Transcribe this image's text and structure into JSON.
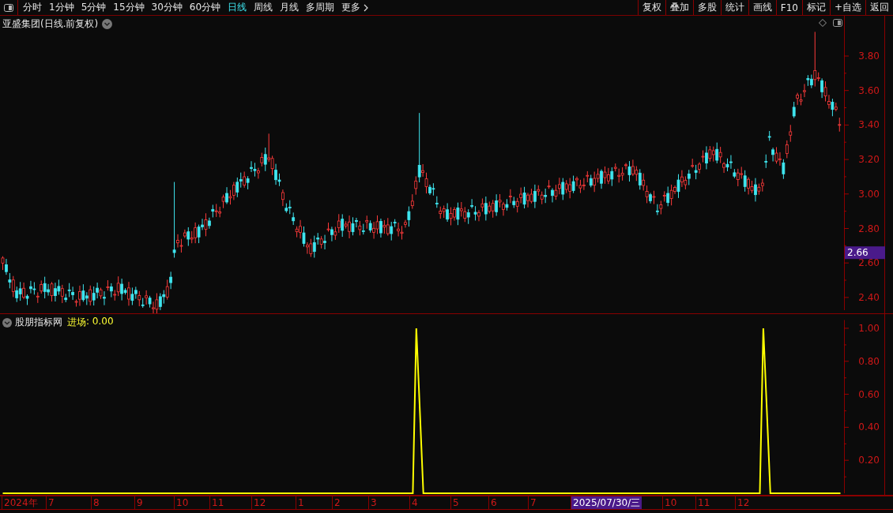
{
  "toolbar": {
    "tabs": [
      {
        "label": "分时",
        "selected": false
      },
      {
        "label": "1分钟",
        "selected": false
      },
      {
        "label": "5分钟",
        "selected": false
      },
      {
        "label": "15分钟",
        "selected": false
      },
      {
        "label": "30分钟",
        "selected": false
      },
      {
        "label": "60分钟",
        "selected": false
      },
      {
        "label": "日线",
        "selected": true
      },
      {
        "label": "周线",
        "selected": false
      },
      {
        "label": "月线",
        "selected": false
      },
      {
        "label": "多周期",
        "selected": false
      },
      {
        "label": "更多",
        "selected": false
      }
    ],
    "buttons": [
      "复权",
      "叠加",
      "多股",
      "统计",
      "画线",
      "F10",
      "标记",
      "+自选",
      "返回"
    ]
  },
  "main_chart": {
    "title": "亚盛集团(日线.前复权)",
    "price_ticks": [
      "3.80",
      "3.60",
      "3.40",
      "3.20",
      "3.00",
      "2.80",
      "2.60",
      "2.40"
    ],
    "current_price": "2.66"
  },
  "indicator": {
    "name": "股朋指标网",
    "readout": ": 0.00",
    "chart_data": {
      "type": "line",
      "categories": [
        null,
        null,
        null,
        null,
        null,
        null,
        null,
        null,
        null,
        null,
        null,
        null,
        null,
        null,
        null,
        null,
        null,
        null,
        null,
        null,
        null,
        null,
        null,
        null,
        null,
        null,
        null,
        null,
        null,
        null,
        null,
        null,
        null,
        null,
        null,
        null,
        null,
        null,
        null,
        null,
        null,
        null,
        null,
        null,
        null,
        null,
        null,
        null,
        null,
        null,
        null,
        null,
        null,
        null,
        null,
        null,
        null,
        null,
        null,
        null,
        null,
        null,
        null,
        null,
        null,
        null,
        null,
        null,
        null,
        null,
        null,
        null,
        null,
        null,
        null,
        null,
        null,
        null,
        null,
        null,
        null,
        null,
        null,
        null,
        null,
        null,
        null,
        null,
        null,
        null,
        null,
        null,
        null,
        null,
        null,
        null,
        null,
        null,
        null,
        null,
        null,
        null,
        null,
        null,
        null,
        null,
        null,
        null,
        null,
        null,
        null,
        null,
        null,
        null,
        null,
        null,
        null,
        null,
        null,
        null,
        null,
        null,
        null,
        null,
        null,
        null,
        null,
        null,
        null,
        null,
        null,
        null,
        null,
        null,
        null,
        null,
        null,
        null,
        null,
        null,
        null,
        null,
        null,
        null,
        null,
        null,
        null,
        null,
        null,
        null,
        null,
        null,
        null,
        null,
        null,
        null,
        null,
        null,
        null,
        null,
        null,
        null,
        null,
        null,
        null,
        null,
        null,
        null,
        null,
        null,
        null,
        null,
        null,
        null,
        null,
        null,
        null,
        null,
        null,
        null,
        null,
        null,
        null,
        null,
        null,
        null,
        null,
        null,
        null,
        null,
        null,
        null,
        null,
        null,
        null,
        null,
        null,
        null,
        null,
        null,
        null,
        null,
        null,
        null,
        null,
        null,
        null,
        null,
        null,
        null,
        null,
        null,
        null,
        null,
        null,
        null,
        null,
        null,
        null,
        null,
        null,
        null,
        null,
        null,
        null,
        null,
        null,
        null,
        null,
        null,
        null,
        null,
        null,
        null,
        null,
        null,
        null,
        null,
        null,
        null
      ],
      "series": [
        {
          "name": "进场",
          "color": "#ffff00",
          "values": [
            0,
            0,
            0,
            0,
            0,
            0,
            0,
            0,
            0,
            0,
            0,
            0,
            0,
            0,
            0,
            0,
            0,
            0,
            0,
            0,
            0,
            0,
            0,
            0,
            0,
            0,
            0,
            0,
            0,
            0,
            0,
            0,
            0,
            0,
            0,
            0,
            0,
            0,
            0,
            0,
            0,
            0,
            0,
            0,
            0,
            0,
            0,
            0,
            0,
            0,
            0,
            0,
            0,
            0,
            0,
            0,
            0,
            0,
            0,
            0,
            0,
            0,
            0,
            0,
            0,
            0,
            0,
            0,
            0,
            0,
            0,
            0,
            0,
            0,
            0,
            0,
            0,
            0,
            0,
            0,
            0,
            0,
            0,
            0,
            0,
            0,
            0,
            0,
            0,
            0,
            0,
            0,
            0,
            0,
            0,
            0,
            0,
            0,
            0,
            0,
            0,
            0,
            0,
            0,
            0,
            0,
            0,
            0,
            0,
            0,
            0,
            0,
            0,
            0,
            0,
            0,
            0,
            0,
            1,
            0.5,
            0,
            0,
            0,
            0,
            0,
            0,
            0,
            0,
            0,
            0,
            0,
            0,
            0,
            0,
            0,
            0,
            0,
            0,
            0,
            0,
            0,
            0,
            0,
            0,
            0,
            0,
            0,
            0,
            0,
            0,
            0,
            0,
            0,
            0,
            0,
            0,
            0,
            0,
            0,
            0,
            0,
            0,
            0,
            0,
            0,
            0,
            0,
            0,
            0,
            0,
            0,
            0,
            0,
            0,
            0,
            0,
            0,
            0,
            0,
            0,
            0,
            0,
            0,
            0,
            0,
            0,
            0,
            0,
            0,
            0,
            0,
            0,
            0,
            0,
            0,
            0,
            0,
            0,
            0,
            0,
            0,
            0,
            0,
            0,
            0,
            0,
            0,
            0,
            0,
            0,
            0,
            0,
            0,
            0,
            0,
            0,
            0,
            1,
            0.5,
            0,
            0,
            0,
            0,
            0,
            0,
            0,
            0,
            0,
            0,
            0,
            0,
            0,
            0,
            0,
            0,
            0,
            0,
            0,
            0,
            0
          ]
        }
      ],
      "ylim": [
        0,
        1.05
      ],
      "yticks": [
        {
          "value": 1,
          "label": "1.00"
        },
        {
          "value": 0.8,
          "label": "0.80"
        },
        {
          "value": 0.6,
          "label": "0.60"
        },
        {
          "value": 0.4,
          "label": "0.40"
        },
        {
          "value": 0.2,
          "label": "0.20"
        }
      ]
    }
  },
  "date_axis": {
    "labels": [
      {
        "text": "2024年",
        "kind": "month"
      },
      {
        "text": "7",
        "kind": "month"
      },
      {
        "text": "8",
        "kind": "month"
      },
      {
        "text": "9",
        "kind": "month"
      },
      {
        "text": "10",
        "kind": "month"
      },
      {
        "text": "11",
        "kind": "month"
      },
      {
        "text": "12",
        "kind": "month"
      },
      {
        "text": "1",
        "kind": "month"
      },
      {
        "text": "2",
        "kind": "month"
      },
      {
        "text": "3",
        "kind": "month"
      },
      {
        "text": "4",
        "kind": "month"
      },
      {
        "text": "5",
        "kind": "month"
      },
      {
        "text": "6",
        "kind": "month"
      },
      {
        "text": "7",
        "kind": "month"
      },
      {
        "text": "2025/07/30/三",
        "kind": "cursor"
      },
      {
        "text": "10",
        "kind": "month"
      },
      {
        "text": "11",
        "kind": "month"
      },
      {
        "text": "12",
        "kind": "month"
      }
    ]
  }
}
